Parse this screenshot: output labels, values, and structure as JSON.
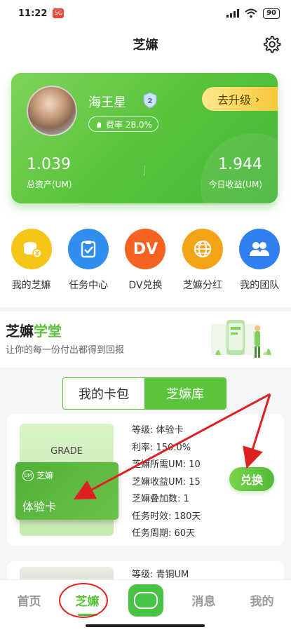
{
  "status_bar": {
    "time": "11:22",
    "app_badge": "5G",
    "battery": "90"
  },
  "header": {
    "title": "芝嫲"
  },
  "profile": {
    "username": "海王星",
    "level": "2",
    "fee_label": "费率 28.0%",
    "upgrade_label": "去升级",
    "total_assets_value": "1.039",
    "total_assets_label": "总资产(UM)",
    "today_income_value": "1.944",
    "today_income_label": "今日收益(UM)"
  },
  "quick_menu": [
    {
      "label": "我的芝嫲",
      "icon": "coins-icon",
      "color": "#f5c518"
    },
    {
      "label": "任务中心",
      "icon": "clipboard-check-icon",
      "color": "#2f8ef0"
    },
    {
      "label": "DV兑换",
      "icon": "dv-icon",
      "color": "#f4631f",
      "text": "DV"
    },
    {
      "label": "芝嫲分红",
      "icon": "globe-icon",
      "color": "#f5a316"
    },
    {
      "label": "我的团队",
      "icon": "team-icon",
      "color": "#2f7ff0"
    }
  ],
  "school": {
    "title_part1": "芝嫲",
    "title_part2": "学堂",
    "subtitle": "让你的每一份付出都得到回报"
  },
  "tabs": {
    "card_pack": "我的卡包",
    "library": "芝嫲库"
  },
  "cards": [
    {
      "grade_tag": "GRADE",
      "brand": "芝嫲",
      "um": "UM",
      "name": "体验卡",
      "level_label": "等级:",
      "level_value": "体验卡",
      "rate_label": "利率:",
      "rate_value": "150.0%",
      "need_label": "芝嫲所需UM:",
      "need_value": "10",
      "income_label": "芝嫲收益UM:",
      "income_value": "15",
      "stack_label": "芝嫲叠加数:",
      "stack_value": "1",
      "duration_label": "任务时效:",
      "duration_value": "180天",
      "cycle_label": "任务周期:",
      "cycle_value": "60天",
      "action": "兑换"
    },
    {
      "level_label": "等级:",
      "level_value": "青铜UM"
    }
  ],
  "bottom_nav": {
    "home": "首页",
    "zhima": "芝嫲",
    "messages": "消息",
    "mine": "我的"
  },
  "colors": {
    "accent": "#5bc43c",
    "annotation": "#e02020"
  }
}
